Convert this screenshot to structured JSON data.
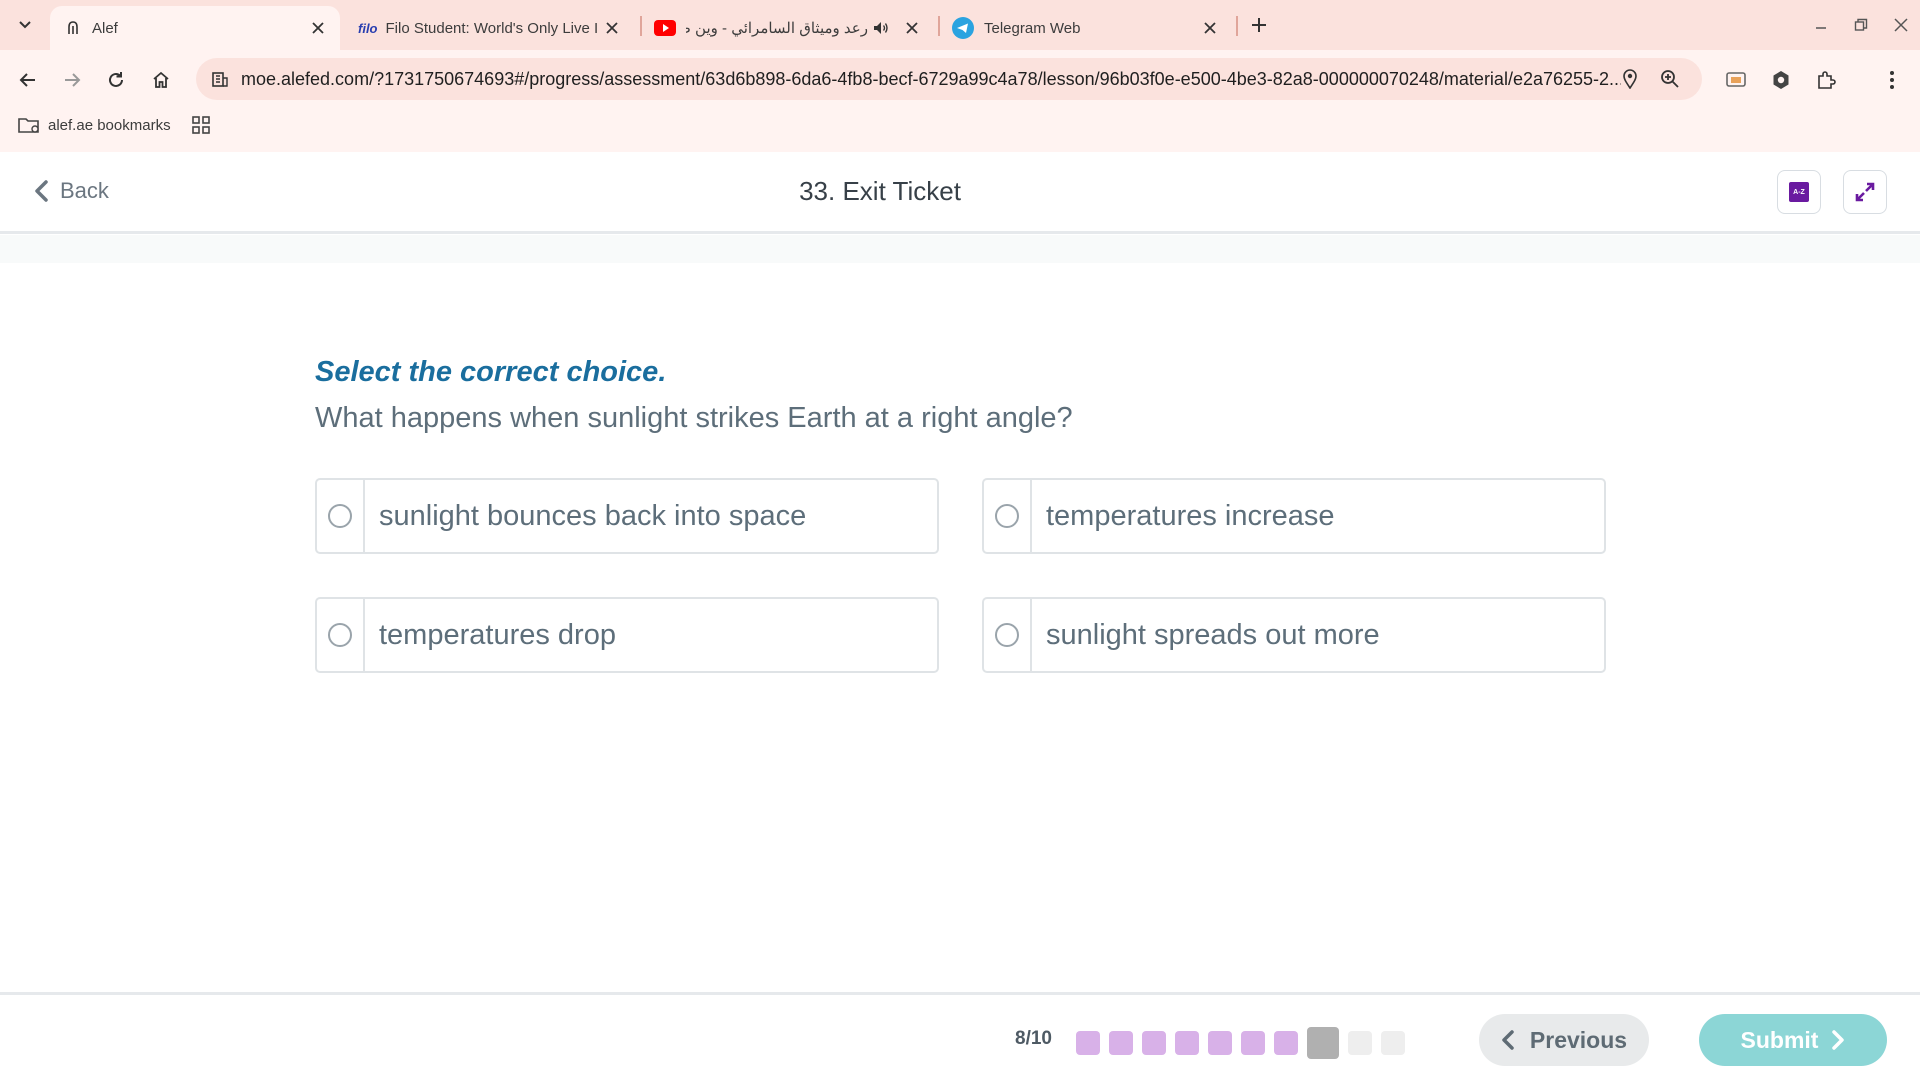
{
  "browser": {
    "tabs": [
      {
        "title": "Alef",
        "icon": "alef-icon",
        "active": true
      },
      {
        "title": "Filo Student: World's Only Live I",
        "icon": "filo-icon",
        "favicon_text": "filo"
      },
      {
        "title": "رعد وميثاق السامرائي - وين صبر",
        "icon": "youtube-icon"
      },
      {
        "title": "Telegram Web",
        "icon": "telegram-icon"
      }
    ],
    "url": "moe.alefed.com/?1731750674693#/progress/assessment/63d6b898-6da6-4fb8-becf-6729a99c4a78/lesson/96b03f0e-e500-4be3-82a8-000000070248/material/e2a76255-2...",
    "bookmarks": [
      {
        "label": "alef.ae bookmarks"
      }
    ]
  },
  "app": {
    "back_label": "Back",
    "lesson_title": "33. Exit Ticket",
    "dictionary_icon_text": "A-Z"
  },
  "question": {
    "prompt": "Select the correct choice.",
    "text": "What happens when sunlight strikes Earth at a right angle?",
    "choices": [
      {
        "label": "sunlight bounces back into space"
      },
      {
        "label": "temperatures increase"
      },
      {
        "label": "temperatures drop"
      },
      {
        "label": "sunlight spreads out more"
      }
    ]
  },
  "footer": {
    "counter": "8/10",
    "progress_states": [
      "done",
      "done",
      "done",
      "done",
      "done",
      "done",
      "done",
      "current",
      "todo",
      "todo"
    ],
    "previous_label": "Previous",
    "submit_label": "Submit"
  },
  "colors": {
    "accent_purple": "#6a1aa0",
    "prompt_blue": "#1a6e9e",
    "submit_teal": "#8cd6d6",
    "progress_done": "#d8b1e8"
  }
}
